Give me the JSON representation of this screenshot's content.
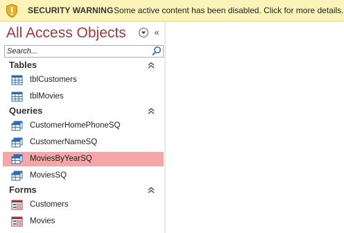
{
  "security_bar": {
    "title": "SECURITY WARNING",
    "message": "Some active content has been disabled. Click for more details.",
    "icon": "shield-warning-icon"
  },
  "nav_pane": {
    "title": "All Access Objects",
    "search_placeholder": "Search...",
    "groups": [
      {
        "label": "Tables",
        "items": [
          {
            "label": "tblCustomers",
            "icon": "table-icon"
          },
          {
            "label": "tblMovies",
            "icon": "table-icon"
          }
        ]
      },
      {
        "label": "Queries",
        "items": [
          {
            "label": "CustomerHomePhoneSQ",
            "icon": "query-icon"
          },
          {
            "label": "CustomerNameSQ",
            "icon": "query-icon"
          },
          {
            "label": "MoviesByYearSQ",
            "icon": "query-icon",
            "selected": true
          },
          {
            "label": "MoviesSQ",
            "icon": "query-icon"
          }
        ]
      },
      {
        "label": "Forms",
        "items": [
          {
            "label": "Customers",
            "icon": "form-icon"
          },
          {
            "label": "Movies",
            "icon": "form-icon"
          }
        ]
      }
    ]
  },
  "colors": {
    "warning_bar": "#fcf3b8",
    "title_accent": "#a4373a",
    "selected_item": "#f4a6a8"
  }
}
